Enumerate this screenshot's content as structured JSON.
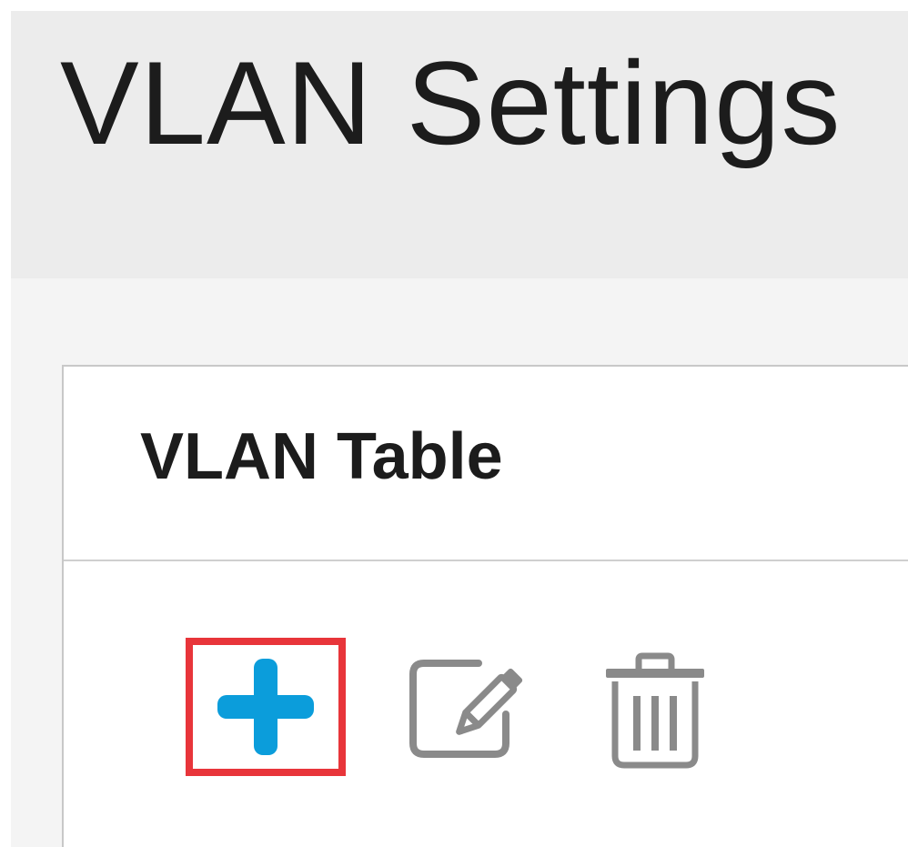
{
  "header": {
    "title": "VLAN Settings"
  },
  "panel": {
    "title": "VLAN Table"
  },
  "toolbar": {
    "add_icon": "plus-icon",
    "edit_icon": "edit-icon",
    "delete_icon": "trash-icon"
  },
  "colors": {
    "add_icon": "#0b9ddb",
    "highlight_border": "#e8353a",
    "tool_icon_gray": "#8a8a8a",
    "header_bg": "#ececec",
    "page_bg": "#f4f4f4"
  }
}
